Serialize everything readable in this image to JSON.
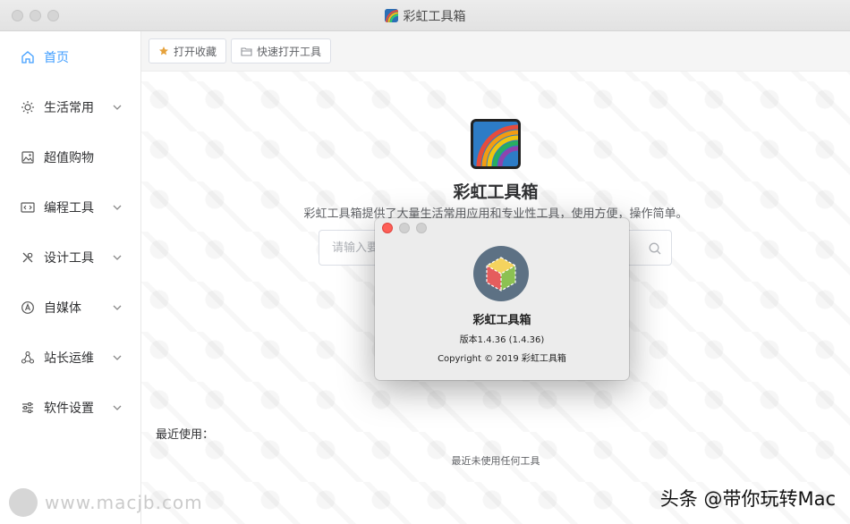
{
  "window": {
    "title": "彩虹工具箱"
  },
  "sidebar": {
    "items": [
      {
        "label": "首页",
        "icon": "home-icon",
        "has_submenu": false,
        "active": true
      },
      {
        "label": "生活常用",
        "icon": "sun-icon",
        "has_submenu": true,
        "active": false
      },
      {
        "label": "超值购物",
        "icon": "image-icon",
        "has_submenu": false,
        "active": false
      },
      {
        "label": "编程工具",
        "icon": "code-icon",
        "has_submenu": true,
        "active": false
      },
      {
        "label": "设计工具",
        "icon": "tools-icon",
        "has_submenu": true,
        "active": false
      },
      {
        "label": "自媒体",
        "icon": "compass-icon",
        "has_submenu": true,
        "active": false
      },
      {
        "label": "站长运维",
        "icon": "network-icon",
        "has_submenu": true,
        "active": false
      },
      {
        "label": "软件设置",
        "icon": "sliders-icon",
        "has_submenu": true,
        "active": false
      }
    ]
  },
  "toolbar": {
    "favorites_label": "打开收藏",
    "quick_open_label": "快速打开工具"
  },
  "main": {
    "app_name": "彩虹工具箱",
    "description": "彩虹工具箱提供了大量生活常用应用和专业性工具，使用方便，操作简单。",
    "search_placeholder": "请输入要",
    "recent_title": "最近使用：",
    "recent_empty": "最近未使用任何工具"
  },
  "about": {
    "name": "彩虹工具箱",
    "version": "版本1.4.36 (1.4.36)",
    "copyright": "Copyright © 2019 彩虹工具箱"
  },
  "watermarks": {
    "left": "www.macjb.com",
    "right": "头条 @带你玩转Mac"
  },
  "colors": {
    "accent": "#409eff",
    "close_button": "#fe5f57"
  }
}
